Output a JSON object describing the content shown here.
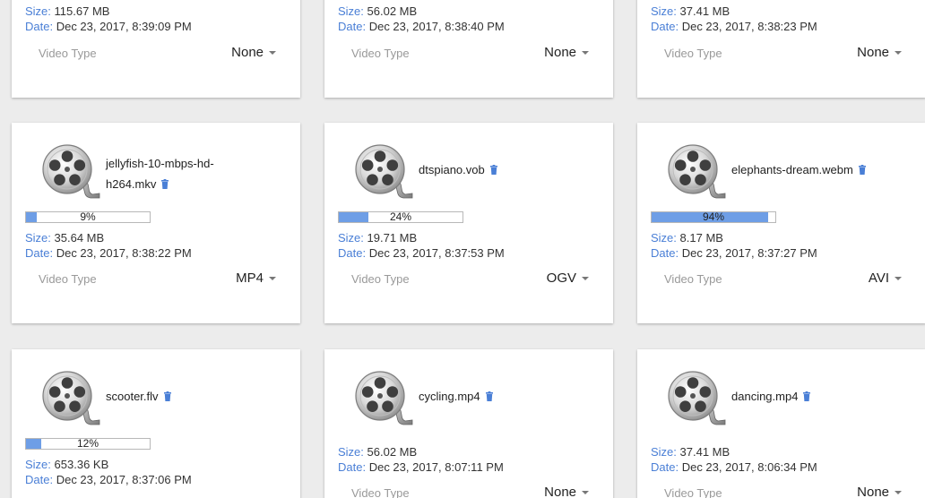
{
  "labels": {
    "size": "Size:",
    "date": "Date:",
    "video_type": "Video Type"
  },
  "accent_color": "#4a7fd6",
  "progress_color": "#6e9ee6",
  "cards": [
    {
      "size": "115.67 MB",
      "date": "Dec 23, 2017, 8:39:09 PM",
      "format": "None"
    },
    {
      "size": "56.02 MB",
      "date": "Dec 23, 2017, 8:38:40 PM",
      "format": "None"
    },
    {
      "size": "37.41 MB",
      "date": "Dec 23, 2017, 8:38:23 PM",
      "format": "None"
    },
    {
      "name": "jellyfish-10-mbps-hd-h264.mkv",
      "progress": 9,
      "progress_label": "9%",
      "size": "35.64 MB",
      "date": "Dec 23, 2017, 8:38:22 PM",
      "format": "MP4"
    },
    {
      "name": "dtspiano.vob",
      "progress": 24,
      "progress_label": "24%",
      "size": "19.71 MB",
      "date": "Dec 23, 2017, 8:37:53 PM",
      "format": "OGV"
    },
    {
      "name": "elephants-dream.webm",
      "progress": 94,
      "progress_label": "94%",
      "size": "8.17 MB",
      "date": "Dec 23, 2017, 8:37:27 PM",
      "format": "AVI"
    },
    {
      "name": "scooter.flv",
      "progress": 12,
      "progress_label": "12%",
      "size": "653.36 KB",
      "date": "Dec 23, 2017, 8:37:06 PM",
      "format": ""
    },
    {
      "name": "cycling.mp4",
      "size": "56.02 MB",
      "date": "Dec 23, 2017, 8:07:11 PM",
      "format": "None"
    },
    {
      "name": "dancing.mp4",
      "size": "37.41 MB",
      "date": "Dec 23, 2017, 8:06:34 PM",
      "format": "None"
    }
  ]
}
